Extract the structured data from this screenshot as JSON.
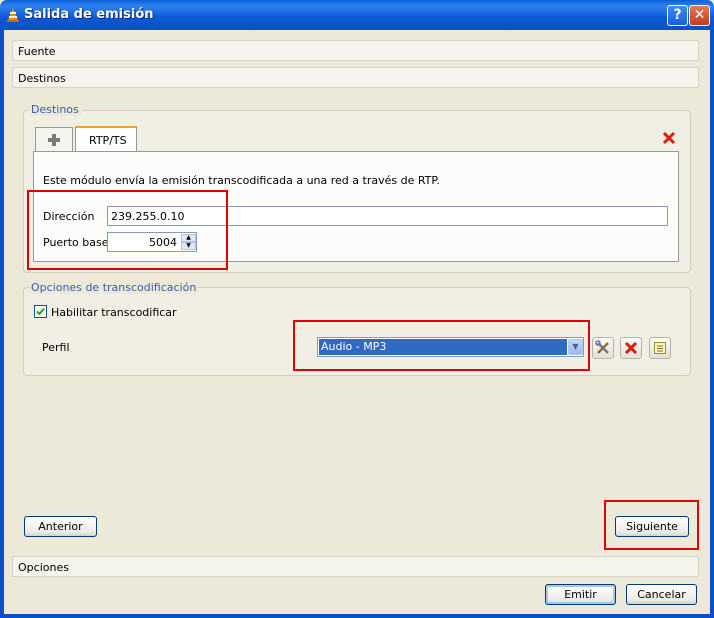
{
  "window": {
    "title": "Salida de emisión",
    "help_label": "?",
    "close_label": "✕"
  },
  "sections": {
    "source": "Fuente",
    "destinations": "Destinos",
    "options": "Opciones"
  },
  "destinations_group": {
    "title": "Destinos",
    "add_tab_icon": "plus-icon",
    "tab_label": "RTP/TS",
    "remove_icon": "red-x-icon",
    "description": "Este módulo envía la emisión transcodificada a una red a través de RTP.",
    "address_label": "Dirección",
    "address_value": "239.255.0.10",
    "port_label": "Puerto base",
    "port_value": "5004"
  },
  "transcode_group": {
    "title": "Opciones de transcodificación",
    "enable_label": "Habilitar transcodificar",
    "enable_checked": true,
    "profile_label": "Perfil",
    "profile_value": "Audio - MP3",
    "edit_icon": "tools-icon",
    "delete_icon": "red-x-icon",
    "new_icon": "new-profile-icon"
  },
  "buttons": {
    "back": "Anterior",
    "next": "Siguiente",
    "stream": "Emitir",
    "cancel": "Cancelar"
  },
  "colors": {
    "titlebar": "#0a5fd8",
    "highlight_box": "#e00000",
    "selected_profile": "#316ac5"
  }
}
